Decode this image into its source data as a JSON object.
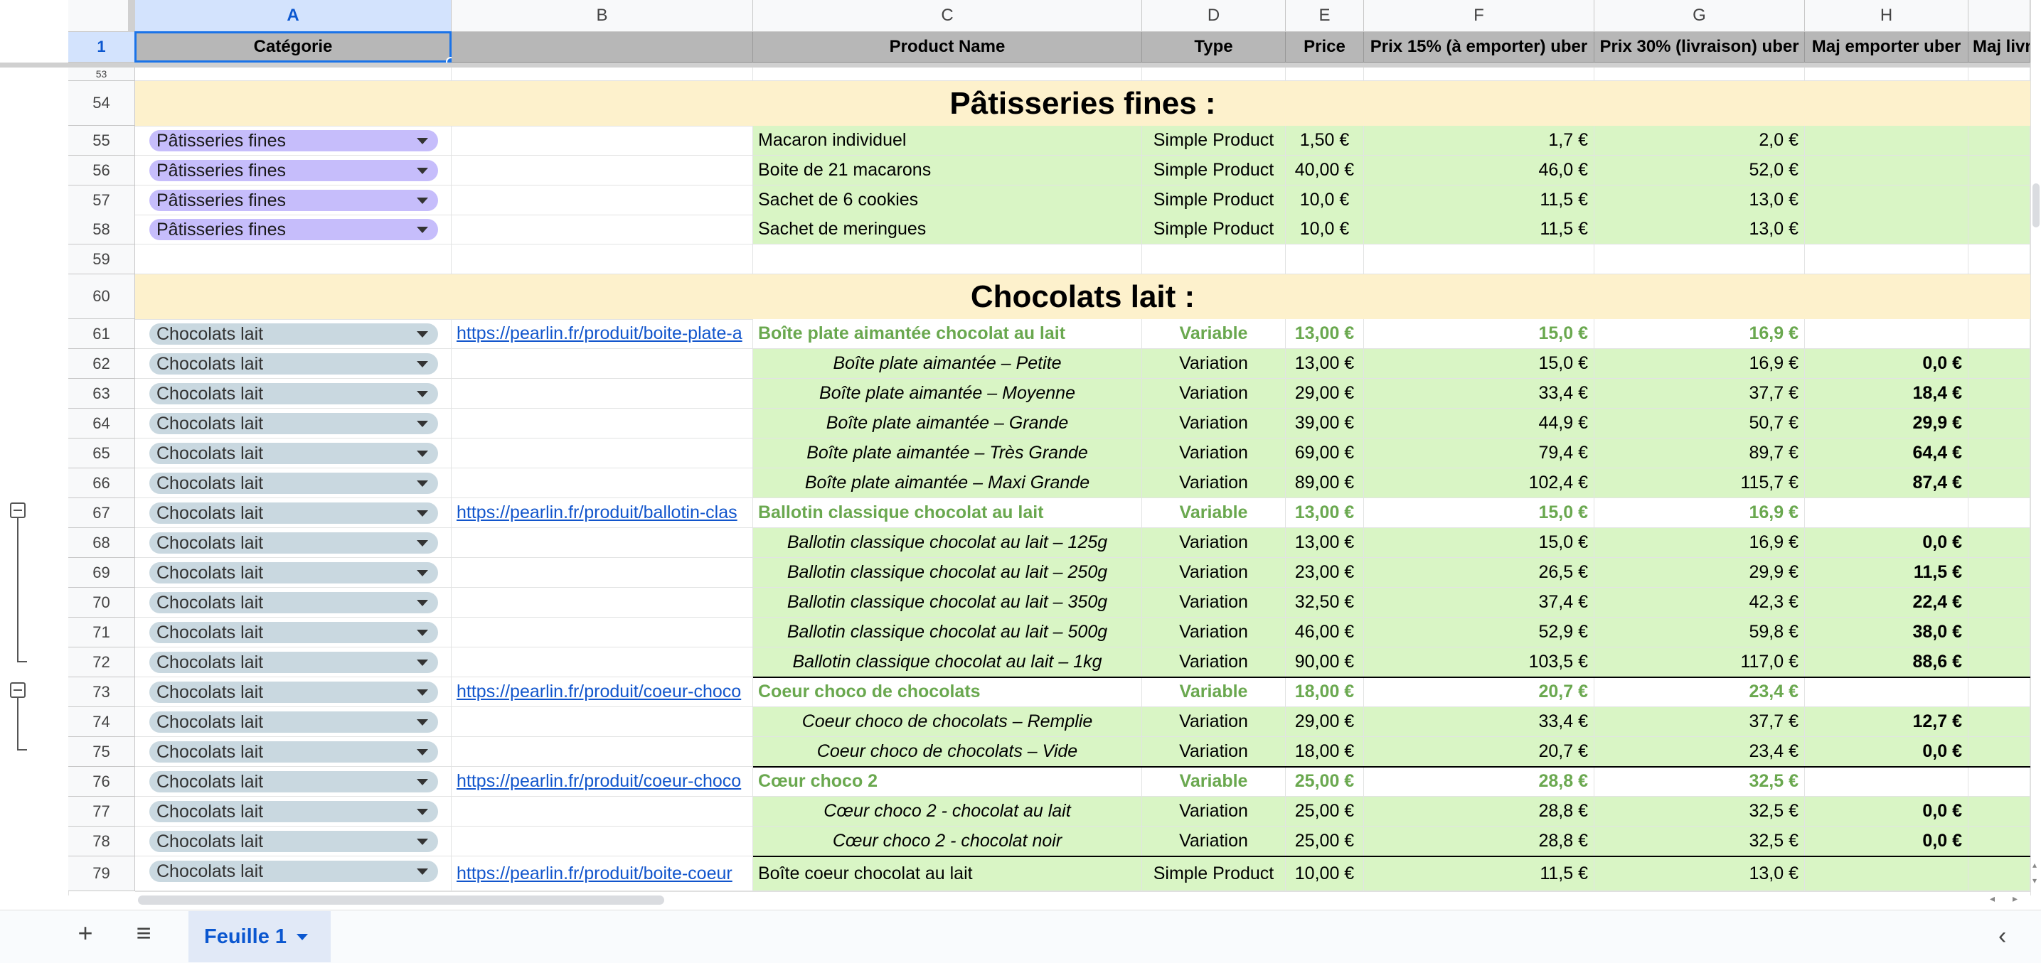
{
  "columns": [
    "A",
    "B",
    "C",
    "D",
    "E",
    "F",
    "G",
    "H"
  ],
  "header_row": {
    "num": "1",
    "A": "Catégorie",
    "B": "",
    "C": "Product Name",
    "D": "Type",
    "E": "Price",
    "F": "Prix 15% (à emporter) uber",
    "G": "Prix 30% (livraison) uber",
    "H": "Maj emporter uber",
    "I": "Maj livr"
  },
  "sections": {
    "patisseries": {
      "row": "54",
      "title": "Pâtisseries fines :"
    },
    "chocolats": {
      "row": "60",
      "title": "Chocolats lait :"
    }
  },
  "rows": [
    {
      "num": "55",
      "cat": "Pâtisseries fines",
      "link": "",
      "name": "Macaron individuel",
      "type": "Simple Product",
      "price": "1,50 €",
      "f": "1,7 €",
      "g": "2,0 €",
      "h": ""
    },
    {
      "num": "56",
      "cat": "Pâtisseries fines",
      "link": "",
      "name": "Boite de 21 macarons",
      "type": "Simple Product",
      "price": "40,00 €",
      "f": "46,0 €",
      "g": "52,0 €",
      "h": ""
    },
    {
      "num": "57",
      "cat": "Pâtisseries fines",
      "link": "",
      "name": "Sachet de 6 cookies",
      "type": "Simple Product",
      "price": "10,0 €",
      "f": "11,5 €",
      "g": "13,0 €",
      "h": ""
    },
    {
      "num": "58",
      "cat": "Pâtisseries fines",
      "link": "",
      "name": "Sachet de meringues",
      "type": "Simple Product",
      "price": "10,0 €",
      "f": "11,5 €",
      "g": "13,0 €",
      "h": ""
    },
    {
      "num": "61",
      "cat": "Chocolats lait",
      "link": "https://pearlin.fr/produit/boite-plate-a",
      "name": "Boîte plate aimantée chocolat au lait",
      "type": "Variable",
      "price": "13,00 €",
      "f": "15,0 €",
      "g": "16,9 €",
      "h": ""
    },
    {
      "num": "62",
      "cat": "Chocolats lait",
      "link": "",
      "name": "Boîte plate aimantée – Petite",
      "type": "Variation",
      "price": "13,00 €",
      "f": "15,0 €",
      "g": "16,9 €",
      "h": "0,0 €"
    },
    {
      "num": "63",
      "cat": "Chocolats lait",
      "link": "",
      "name": "Boîte plate aimantée – Moyenne",
      "type": "Variation",
      "price": "29,00 €",
      "f": "33,4 €",
      "g": "37,7 €",
      "h": "18,4 €"
    },
    {
      "num": "64",
      "cat": "Chocolats lait",
      "link": "",
      "name": "Boîte plate aimantée – Grande",
      "type": "Variation",
      "price": "39,00 €",
      "f": "44,9 €",
      "g": "50,7 €",
      "h": "29,9 €"
    },
    {
      "num": "65",
      "cat": "Chocolats lait",
      "link": "",
      "name": "Boîte plate aimantée – Très Grande",
      "type": "Variation",
      "price": "69,00 €",
      "f": "79,4 €",
      "g": "89,7 €",
      "h": "64,4 €"
    },
    {
      "num": "66",
      "cat": "Chocolats lait",
      "link": "",
      "name": "Boîte plate aimantée –  Maxi Grande",
      "type": "Variation",
      "price": "89,00 €",
      "f": "102,4 €",
      "g": "115,7 €",
      "h": "87,4 €"
    },
    {
      "num": "67",
      "cat": "Chocolats lait",
      "link": "https://pearlin.fr/produit/ballotin-clas",
      "name": "Ballotin classique chocolat au lait",
      "type": "Variable",
      "price": "13,00 €",
      "f": "15,0 €",
      "g": "16,9 €",
      "h": ""
    },
    {
      "num": "68",
      "cat": "Chocolats lait",
      "link": "",
      "name": "Ballotin classique chocolat au lait – 125g",
      "type": "Variation",
      "price": "13,00 €",
      "f": "15,0 €",
      "g": "16,9 €",
      "h": "0,0 €"
    },
    {
      "num": "69",
      "cat": "Chocolats lait",
      "link": "",
      "name": "Ballotin classique chocolat au lait – 250g",
      "type": "Variation",
      "price": "23,00 €",
      "f": "26,5 €",
      "g": "29,9 €",
      "h": "11,5 €"
    },
    {
      "num": "70",
      "cat": "Chocolats lait",
      "link": "",
      "name": "Ballotin classique chocolat au lait – 350g",
      "type": "Variation",
      "price": "32,50 €",
      "f": "37,4 €",
      "g": "42,3 €",
      "h": "22,4 €"
    },
    {
      "num": "71",
      "cat": "Chocolats lait",
      "link": "",
      "name": "Ballotin classique chocolat au lait – 500g",
      "type": "Variation",
      "price": "46,00 €",
      "f": "52,9 €",
      "g": "59,8 €",
      "h": "38,0 €"
    },
    {
      "num": "72",
      "cat": "Chocolats lait",
      "link": "",
      "name": "Ballotin classique chocolat au lait – 1kg",
      "type": "Variation",
      "price": "90,00 €",
      "f": "103,5 €",
      "g": "117,0 €",
      "h": "88,6 €"
    },
    {
      "num": "73",
      "cat": "Chocolats lait",
      "link": "https://pearlin.fr/produit/coeur-choco",
      "name": "Coeur choco de chocolats",
      "type": "Variable",
      "price": "18,00 €",
      "f": "20,7 €",
      "g": "23,4 €",
      "h": ""
    },
    {
      "num": "74",
      "cat": "Chocolats lait",
      "link": "",
      "name": "Coeur choco de chocolats – Remplie",
      "type": "Variation",
      "price": "29,00 €",
      "f": "33,4 €",
      "g": "37,7 €",
      "h": "12,7 €"
    },
    {
      "num": "75",
      "cat": "Chocolats lait",
      "link": "",
      "name": "Coeur choco de chocolats – Vide",
      "type": "Variation",
      "price": "18,00 €",
      "f": "20,7 €",
      "g": "23,4 €",
      "h": "0,0 €"
    },
    {
      "num": "76",
      "cat": "Chocolats lait",
      "link": "https://pearlin.fr/produit/coeur-choco",
      "name": "Cœur choco 2",
      "type": "Variable",
      "price": "25,00 €",
      "f": "28,8 €",
      "g": "32,5 €",
      "h": ""
    },
    {
      "num": "77",
      "cat": "Chocolats lait",
      "link": "",
      "name": "Cœur choco 2 - chocolat au lait",
      "type": "Variation",
      "price": "25,00 €",
      "f": "28,8 €",
      "g": "32,5 €",
      "h": "0,0 €"
    },
    {
      "num": "78",
      "cat": "Chocolats lait",
      "link": "",
      "name": "Cœur choco 2 - chocolat noir",
      "type": "Variation",
      "price": "25,00 €",
      "f": "28,8 €",
      "g": "32,5 €",
      "h": "0,0 €"
    },
    {
      "num": "79",
      "cat": "Chocolats lait",
      "link": "https://pearlin.fr/produit/boite-coeur",
      "name": "Boîte coeur chocolat au lait",
      "type": "Simple Product",
      "price": "10,00 €",
      "f": "11,5 €",
      "g": "13,0 €",
      "h": ""
    }
  ],
  "empty_row_59": "59",
  "partial_row_top": "53",
  "tabs": {
    "add_label": "+",
    "menu_label": "≡",
    "active_sheet": "Feuille 1"
  },
  "colors": {
    "accent": "#1a73e8",
    "header_bg": "#b7b7b7",
    "section_bg": "#fdf1cc",
    "green_bg": "#d9f5c5",
    "variable_text": "#6aa84f",
    "chip_pat": "#c6bdfb",
    "chip_choc": "#c9d8e0"
  }
}
